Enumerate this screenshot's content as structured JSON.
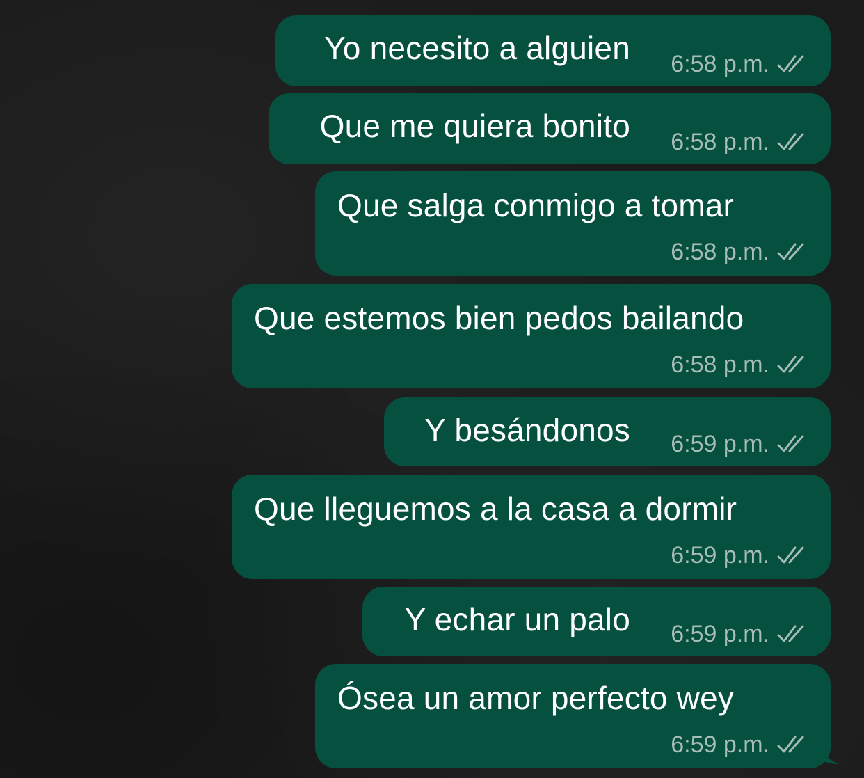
{
  "chat": {
    "colors": {
      "background": "#1b1b1b",
      "bubble": "#06503f",
      "text": "#ffffff",
      "meta": "#a7bdb6"
    },
    "messages": [
      {
        "text": "Yo necesito a alguien",
        "time": "6:58 p.m.",
        "status_icon": "double-check-icon"
      },
      {
        "text": "Que me quiera bonito",
        "time": "6:58 p.m.",
        "status_icon": "double-check-icon"
      },
      {
        "text": "Que salga conmigo a tomar",
        "time": "6:58 p.m.",
        "status_icon": "double-check-icon"
      },
      {
        "text": "Que estemos bien pedos bailando",
        "time": "6:58 p.m.",
        "status_icon": "double-check-icon"
      },
      {
        "text": "Y besándonos",
        "time": "6:59 p.m.",
        "status_icon": "double-check-icon"
      },
      {
        "text": "Que lleguemos a la casa a dormir",
        "time": "6:59 p.m.",
        "status_icon": "double-check-icon"
      },
      {
        "text": "Y echar un palo",
        "time": "6:59 p.m.",
        "status_icon": "double-check-icon"
      },
      {
        "text": "Ósea un amor perfecto wey",
        "time": "6:59 p.m.",
        "status_icon": "double-check-icon"
      }
    ]
  }
}
